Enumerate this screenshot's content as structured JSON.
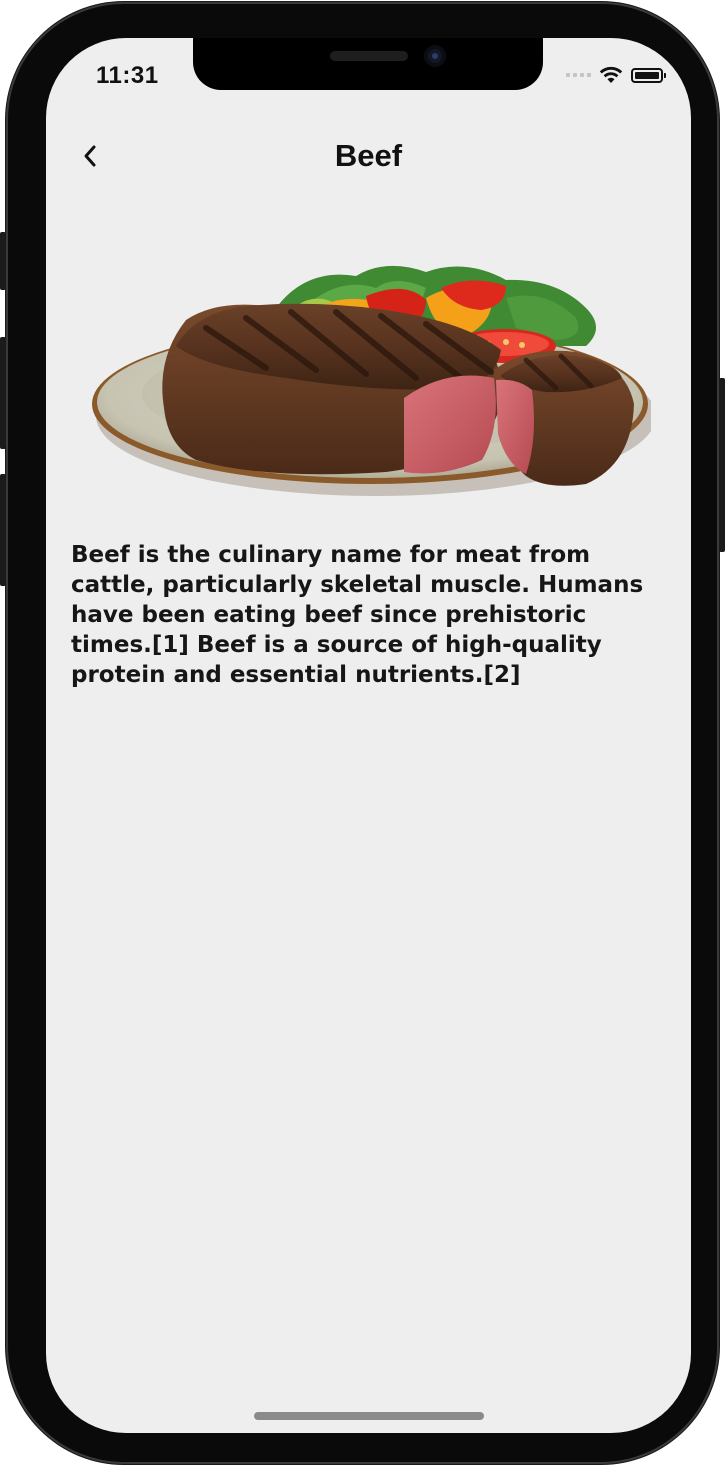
{
  "status_bar": {
    "time": "11:31",
    "signal_icon": "cellular-signal-icon",
    "wifi_icon": "wifi-icon",
    "battery_icon": "battery-icon"
  },
  "nav_bar": {
    "back_icon": "chevron-left-icon",
    "title": "Beef"
  },
  "content": {
    "image_subject": "grilled steak on plate",
    "description": "Beef is the culinary name for meat from cattle, particularly skeletal muscle. Humans have been eating beef since prehistoric times.[1] Beef is a source of high-quality protein and essential nutrients.[2]"
  },
  "colors": {
    "background": "#eeeeef",
    "text": "#161616",
    "frame": "#0a0a0a"
  }
}
